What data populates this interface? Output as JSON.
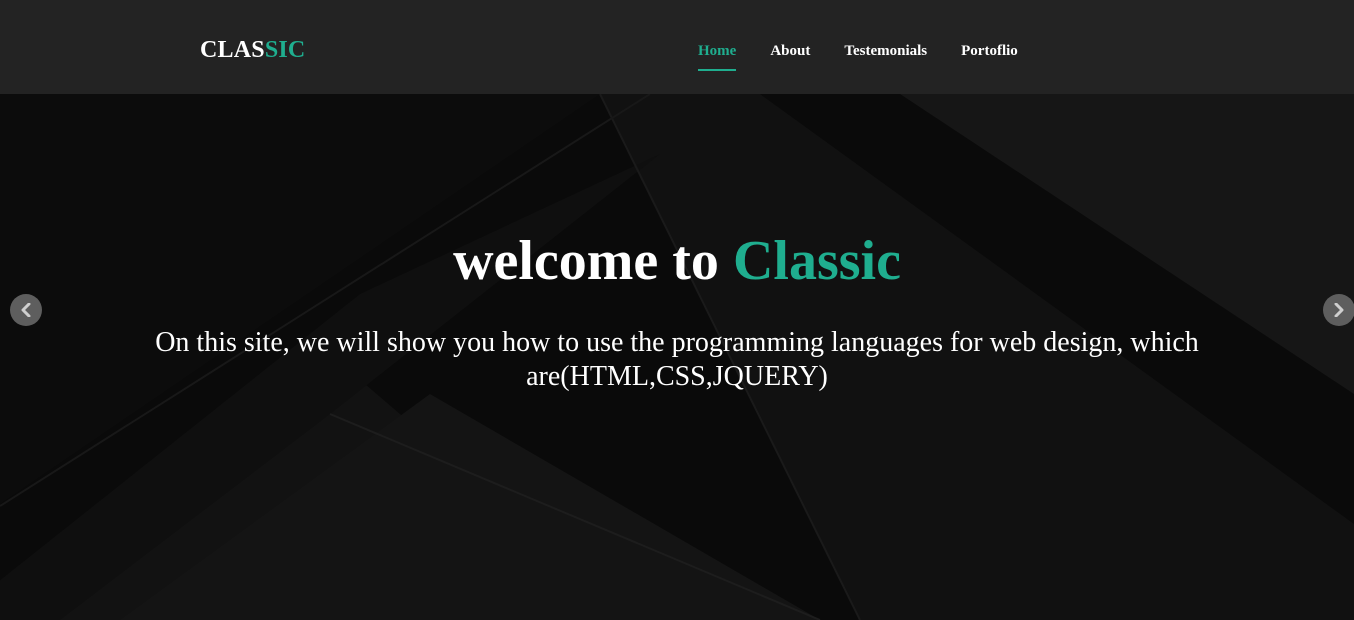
{
  "brand": {
    "part1": "CLAS",
    "part2": "SIC",
    "accent_color": "#1fae8f"
  },
  "nav": {
    "items": [
      {
        "label": "Home",
        "active": true
      },
      {
        "label": "About"
      },
      {
        "label": "Testemonials"
      },
      {
        "label": "Portoflio"
      }
    ]
  },
  "hero": {
    "title_prefix": "welcome to",
    "title_accent": "Classic",
    "subtitle": "On this site, we will show you how to use the programming languages for web design, which are(HTML,CSS,JQUERY)"
  },
  "carousel": {
    "prev_icon": "chevron-left-icon",
    "next_icon": "chevron-right-icon"
  }
}
